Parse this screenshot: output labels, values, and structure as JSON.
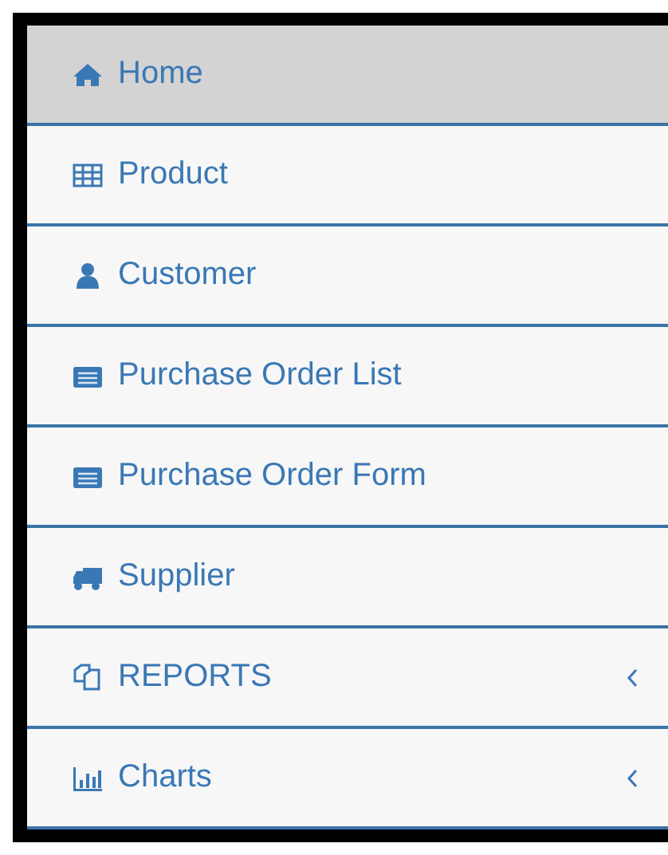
{
  "sidebar": {
    "items": [
      {
        "label": "Home",
        "selected": true,
        "submenu": false
      },
      {
        "label": "Product",
        "selected": false,
        "submenu": false
      },
      {
        "label": "Customer",
        "selected": false,
        "submenu": false
      },
      {
        "label": "Purchase Order List",
        "selected": false,
        "submenu": false
      },
      {
        "label": "Purchase Order Form",
        "selected": false,
        "submenu": false
      },
      {
        "label": "Supplier",
        "selected": false,
        "submenu": false
      },
      {
        "label": "REPORTS",
        "selected": false,
        "submenu": true
      },
      {
        "label": "Charts",
        "selected": false,
        "submenu": true
      }
    ]
  }
}
